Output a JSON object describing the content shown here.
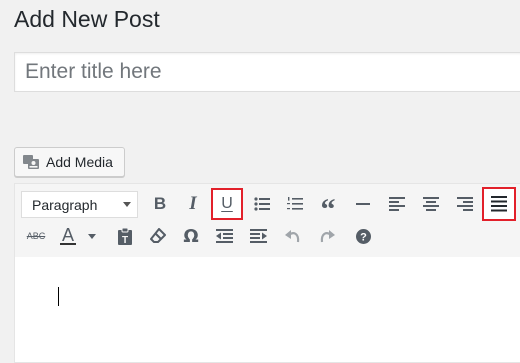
{
  "page": {
    "title": "Add New Post"
  },
  "title_field": {
    "placeholder": "Enter title here",
    "value": ""
  },
  "media": {
    "add_media_label": "Add Media"
  },
  "toolbar": {
    "format_select": {
      "selected": "Paragraph"
    },
    "row1": [
      {
        "name": "bold",
        "glyph": "B"
      },
      {
        "name": "italic",
        "glyph": "I"
      },
      {
        "name": "underline",
        "glyph": "U",
        "highlighted": true
      },
      {
        "name": "bulleted-list"
      },
      {
        "name": "numbered-list"
      },
      {
        "name": "blockquote",
        "glyph": "“"
      },
      {
        "name": "horizontal-line"
      },
      {
        "name": "align-left"
      },
      {
        "name": "align-center"
      },
      {
        "name": "align-right"
      },
      {
        "name": "justify",
        "highlighted": true
      }
    ],
    "row2": [
      {
        "name": "strikethrough",
        "glyph": "ABC"
      },
      {
        "name": "text-color",
        "glyph": "A"
      },
      {
        "name": "paste-as-text"
      },
      {
        "name": "clear-formatting"
      },
      {
        "name": "special-character",
        "glyph": "Ω"
      },
      {
        "name": "decrease-indent"
      },
      {
        "name": "increase-indent"
      },
      {
        "name": "undo"
      },
      {
        "name": "redo"
      },
      {
        "name": "keyboard-shortcuts"
      }
    ],
    "highlight_color": "#e2202a"
  },
  "editor": {
    "content": ""
  }
}
